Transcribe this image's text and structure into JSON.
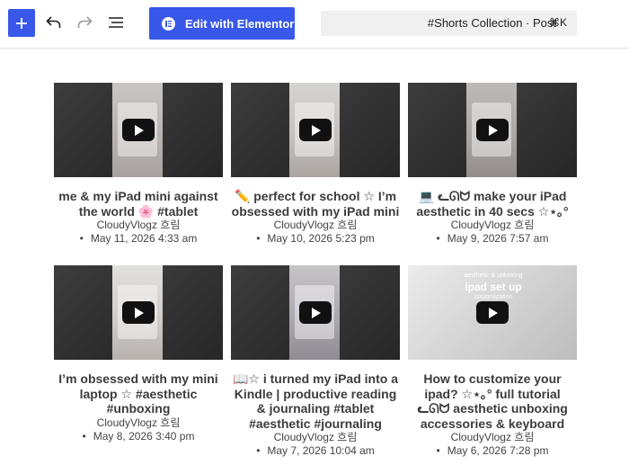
{
  "toolbar": {
    "add_label": "+",
    "undo_icon": "undo-icon",
    "redo_icon": "redo-icon",
    "list_view_icon": "list-view-icon",
    "elementor_label": "Edit with Elementor",
    "command_title": "#Shorts Collection · Post",
    "command_shortcut": "⌘K",
    "accent": "#3858e9"
  },
  "videos": [
    {
      "title": "me & my iPad mini against the world 🌸 #tablet",
      "author": "CloudyVlogz 흐림",
      "date": "May 11, 2026 4:33 am",
      "caption": ""
    },
    {
      "title": "✏️ perfect for school ☆ I’m obsessed with my iPad mini",
      "author": "CloudyVlogz 흐림",
      "date": "May 10, 2026 5:23 pm",
      "caption": ""
    },
    {
      "title": "💻 ᓚᘏᗢ make your iPad aesthetic in 40 secs ☆⋆｡°",
      "author": "CloudyVlogz 흐림",
      "date": "May 9, 2026 7:57 am",
      "caption": ""
    },
    {
      "title": "I’m obsessed with my mini laptop ☆ #aesthetic #unboxing",
      "author": "CloudyVlogz 흐림",
      "date": "May 8, 2026 3:40 pm",
      "caption": ""
    },
    {
      "title": "📖☆ i turned my iPad into a Kindle | productive reading & journaling #tablet #aesthetic #journaling",
      "author": "CloudyVlogz 흐림",
      "date": "May 7, 2026 10:04 am",
      "caption": ""
    },
    {
      "title": "How to customize your ipad? ☆⋆｡° full tutorial ᓚᘏᗢ aesthetic unboxing accessories & keyboard",
      "author": "CloudyVlogz 흐림",
      "date": "May 6, 2026 7:28 pm",
      "caption": "aesthetic & unboxing",
      "overlay": "ipad set up",
      "overlay_sub": "customization"
    }
  ],
  "bullet": "•"
}
